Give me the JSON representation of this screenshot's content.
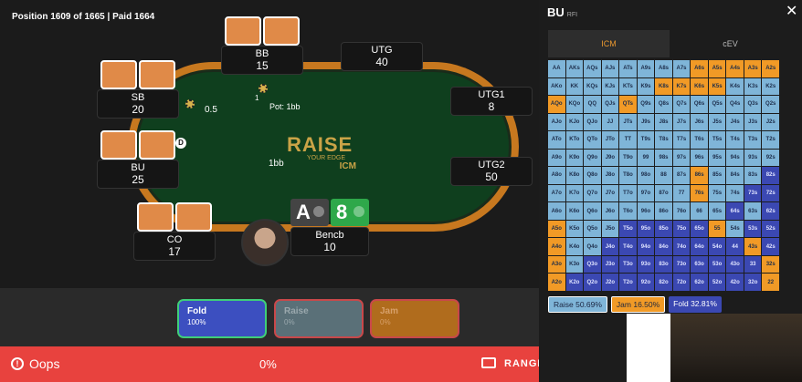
{
  "status": {
    "position_label": "Position 1609 of 1665  |  Paid 1664"
  },
  "seats": {
    "bb": {
      "name": "BB",
      "stack": "15"
    },
    "utg": {
      "name": "UTG",
      "stack": "40"
    },
    "sb": {
      "name": "SB",
      "stack": "20"
    },
    "utg1": {
      "name": "UTG1",
      "stack": "8"
    },
    "bu": {
      "name": "BU",
      "stack": "25"
    },
    "utg2": {
      "name": "UTG2",
      "stack": "50"
    },
    "co": {
      "name": "CO",
      "stack": "17"
    },
    "hero": {
      "name": "Bencb",
      "stack": "10"
    }
  },
  "table": {
    "pot_label": "Pot: 1bb",
    "pot_chip_num": "1",
    "sb_bet": "0.5",
    "bu_bet": "1bb",
    "dealer": "D",
    "logo_main": "RAISE",
    "logo_sub": "YOUR EDGE",
    "logo_icm": "ICM"
  },
  "hero_cards": [
    "A",
    "8"
  ],
  "actions": {
    "fold": {
      "label": "Fold",
      "pct": "100%"
    },
    "raise": {
      "label": "Raise",
      "pct": "0%"
    },
    "jam": {
      "label": "Jam",
      "pct": "0%"
    }
  },
  "bottom_bar": {
    "result": "Oops",
    "score": "0%",
    "range_label": "RANGE"
  },
  "panel": {
    "title": "BU",
    "subtitle": "RFI",
    "tabs": [
      "ICM",
      "cEV"
    ],
    "legend": {
      "raise": "Raise 50.69%",
      "jam": "Jam 16.50%",
      "fold": "Fold 32.81%"
    }
  },
  "range_grid": [
    [
      "AA",
      "AKs",
      "AQs",
      "AJs",
      "ATs",
      "A9s",
      "A8s",
      "A7s",
      "A6s",
      "A5s",
      "A4s",
      "A3s",
      "A2s"
    ],
    [
      "AKo",
      "KK",
      "KQs",
      "KJs",
      "KTs",
      "K9s",
      "K8s",
      "K7s",
      "K6s",
      "K5s",
      "K4s",
      "K3s",
      "K2s"
    ],
    [
      "AQo",
      "KQo",
      "QQ",
      "QJs",
      "QTs",
      "Q9s",
      "Q8s",
      "Q7s",
      "Q6s",
      "Q5s",
      "Q4s",
      "Q3s",
      "Q2s"
    ],
    [
      "AJo",
      "KJo",
      "QJo",
      "JJ",
      "JTs",
      "J9s",
      "J8s",
      "J7s",
      "J6s",
      "J5s",
      "J4s",
      "J3s",
      "J2s"
    ],
    [
      "ATo",
      "KTo",
      "QTo",
      "JTo",
      "TT",
      "T9s",
      "T8s",
      "T7s",
      "T6s",
      "T5s",
      "T4s",
      "T3s",
      "T2s"
    ],
    [
      "A9o",
      "K9o",
      "Q9o",
      "J9o",
      "T9o",
      "99",
      "98s",
      "97s",
      "96s",
      "95s",
      "94s",
      "93s",
      "92s"
    ],
    [
      "A8o",
      "K8o",
      "Q8o",
      "J8o",
      "T8o",
      "98o",
      "88",
      "87s",
      "86s",
      "85s",
      "84s",
      "83s",
      "82s"
    ],
    [
      "A7o",
      "K7o",
      "Q7o",
      "J7o",
      "T7o",
      "97o",
      "87o",
      "77",
      "76s",
      "75s",
      "74s",
      "73s",
      "72s"
    ],
    [
      "A6o",
      "K6o",
      "Q6o",
      "J6o",
      "T6o",
      "96o",
      "86o",
      "76o",
      "66",
      "65s",
      "64s",
      "63s",
      "62s"
    ],
    [
      "A5o",
      "K5o",
      "Q5o",
      "J5o",
      "T5o",
      "95o",
      "85o",
      "75o",
      "65o",
      "55",
      "54s",
      "53s",
      "52s"
    ],
    [
      "A4o",
      "K4o",
      "Q4o",
      "J4o",
      "T4o",
      "94o",
      "84o",
      "74o",
      "64o",
      "54o",
      "44",
      "43s",
      "42s"
    ],
    [
      "A3o",
      "K3o",
      "Q3o",
      "J3o",
      "T3o",
      "93o",
      "83o",
      "73o",
      "63o",
      "53o",
      "43o",
      "33",
      "32s"
    ],
    [
      "A2o",
      "K2o",
      "Q2o",
      "J2o",
      "T2o",
      "92o",
      "82o",
      "72o",
      "62o",
      "52o",
      "42o",
      "32o",
      "22"
    ]
  ],
  "range_actions": [
    "ffffffffjjjjj",
    "ffffffjjjjfff",
    "jfffjfffffffff",
    "ffffffffffffff",
    "ffffffffffffff",
    "ffffffffffffff",
    "ffffffffjfffdd",
    "ffffffffjffdd",
    "ffffffffffdfdd",
    "jfffdddddjfdd",
    "jffddddddddjdd",
    "jfddddddddddjd",
    "jdddddddddddj"
  ],
  "colors": {
    "fold_cell": "#7fb5d8",
    "jam_cell": "#f19a26",
    "dark_cell": "#3b48b2"
  },
  "icons": {
    "close": "close-icon",
    "range": "range-icon",
    "oops": "oops-icon"
  }
}
